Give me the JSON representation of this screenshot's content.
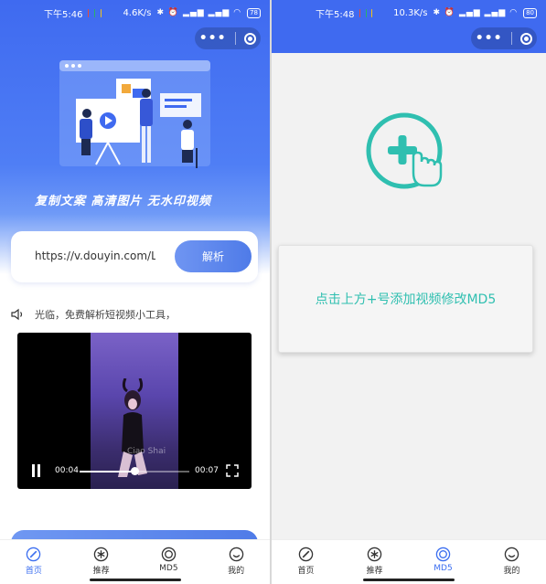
{
  "left": {
    "status": {
      "time": "下午5:46",
      "speed": "4.6K/s",
      "battery": "78"
    },
    "slogan": "复制文案  高清图片  无水印视频",
    "url_input": {
      "value": "https://v.douyin.com/LgMC"
    },
    "parse_button": "解析",
    "notice": {
      "fragment": "光临，免费解析短视频小工具，"
    },
    "video": {
      "watermark": "Ciao Shai",
      "current_time": "00:04",
      "duration": "00:07",
      "progress": 0.5
    }
  },
  "right": {
    "status": {
      "time": "下午5:48",
      "speed": "10.3K/s",
      "battery": "80"
    },
    "hint": "点击上方+号添加视频修改MD5"
  },
  "tabs": [
    {
      "label": "首页",
      "icon": "compass-icon"
    },
    {
      "label": "推荐",
      "icon": "asterisk-icon"
    },
    {
      "label": "MD5",
      "icon": "target-icon"
    },
    {
      "label": "我的",
      "icon": "smile-icon"
    }
  ],
  "left_active_tab": 0,
  "right_active_tab": 2,
  "colors": {
    "brand_blue": "#3f6af0",
    "accent_teal": "#2fbfb0",
    "tab_active": "#3b6ef0"
  }
}
